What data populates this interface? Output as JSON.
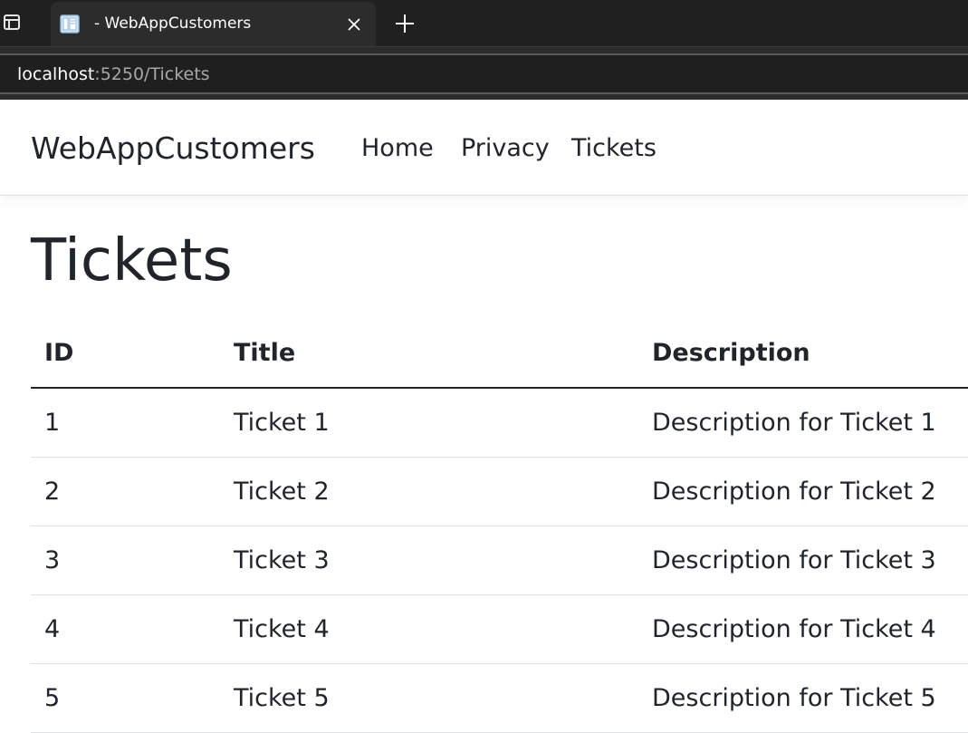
{
  "browser": {
    "tab_title": "- WebAppCustomers",
    "url_host": "localhost",
    "url_rest": ":5250/Tickets",
    "icons": {
      "window": "window-icon",
      "favicon": "page-icon",
      "close": "close-icon",
      "new_tab": "plus-icon"
    }
  },
  "navbar": {
    "brand": "WebAppCustomers",
    "links": [
      "Home",
      "Privacy",
      "Tickets"
    ]
  },
  "page": {
    "title": "Tickets"
  },
  "table": {
    "headers": [
      "ID",
      "Title",
      "Description"
    ],
    "rows": [
      [
        "1",
        "Ticket 1",
        "Description for Ticket 1"
      ],
      [
        "2",
        "Ticket 2",
        "Description for Ticket 2"
      ],
      [
        "3",
        "Ticket 3",
        "Description for Ticket 3"
      ],
      [
        "4",
        "Ticket 4",
        "Description for Ticket 4"
      ],
      [
        "5",
        "Ticket 5",
        "Description for Ticket 5"
      ]
    ]
  },
  "colors": {
    "chrome_background": "#202020",
    "active_tab": "#2c2c2c",
    "page_text": "#212529",
    "row_border": "#dee2e6"
  }
}
